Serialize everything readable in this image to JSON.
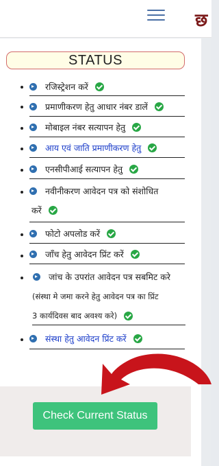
{
  "header": {
    "menu_icon": "hamburger-menu-icon",
    "brand_text": "छ"
  },
  "status": {
    "title": "STATUS",
    "steps": [
      {
        "label": "रजिस्ट्रेशन करें",
        "done": true,
        "style": "normal"
      },
      {
        "label": "प्रमाणीकरण हेतु आधार नंबर डालें",
        "done": true,
        "style": "normal"
      },
      {
        "label": "मोबाइल नंबर सत्यापन हेतु",
        "done": true,
        "style": "normal"
      },
      {
        "label": "आय एवं जाति प्रमाणीकरण हेतु",
        "done": true,
        "style": "link"
      },
      {
        "label": "एनसीपीआई सत्यापन हेतु",
        "done": true,
        "style": "normal"
      },
      {
        "label_line1": "नवीनीकरण आवेदन पत्र को संशोधित",
        "label_line2": "करें",
        "done": true,
        "style": "normal"
      },
      {
        "label": "फोटो अपलोड करें",
        "done": true,
        "style": "normal"
      },
      {
        "label": "जाँच हेतु आवेदन प्रिंट करें",
        "done": true,
        "style": "normal"
      },
      {
        "label_line1": "जांच के उपरांत आवेदन पत्र सबमिट करे",
        "label_line2": "(संस्था मे जमा करने हेतु आवेदन पत्र का प्रिंट",
        "label_line3": "3 कार्यदिवस बाद अवश्य करे)",
        "done": true,
        "style": "normal"
      },
      {
        "label": "संस्था हेतु आवेदन प्रिंट करें",
        "done": true,
        "style": "link"
      }
    ]
  },
  "actions": {
    "check_button_label": "Check Current Status"
  },
  "colors": {
    "accent_green": "#3ec37c",
    "check_green": "#28a745",
    "arrow_blue": "#2f6fb0",
    "link_blue": "#1a3cc9",
    "status_border": "#d26a6a",
    "red_arrow": "#c8141b"
  }
}
